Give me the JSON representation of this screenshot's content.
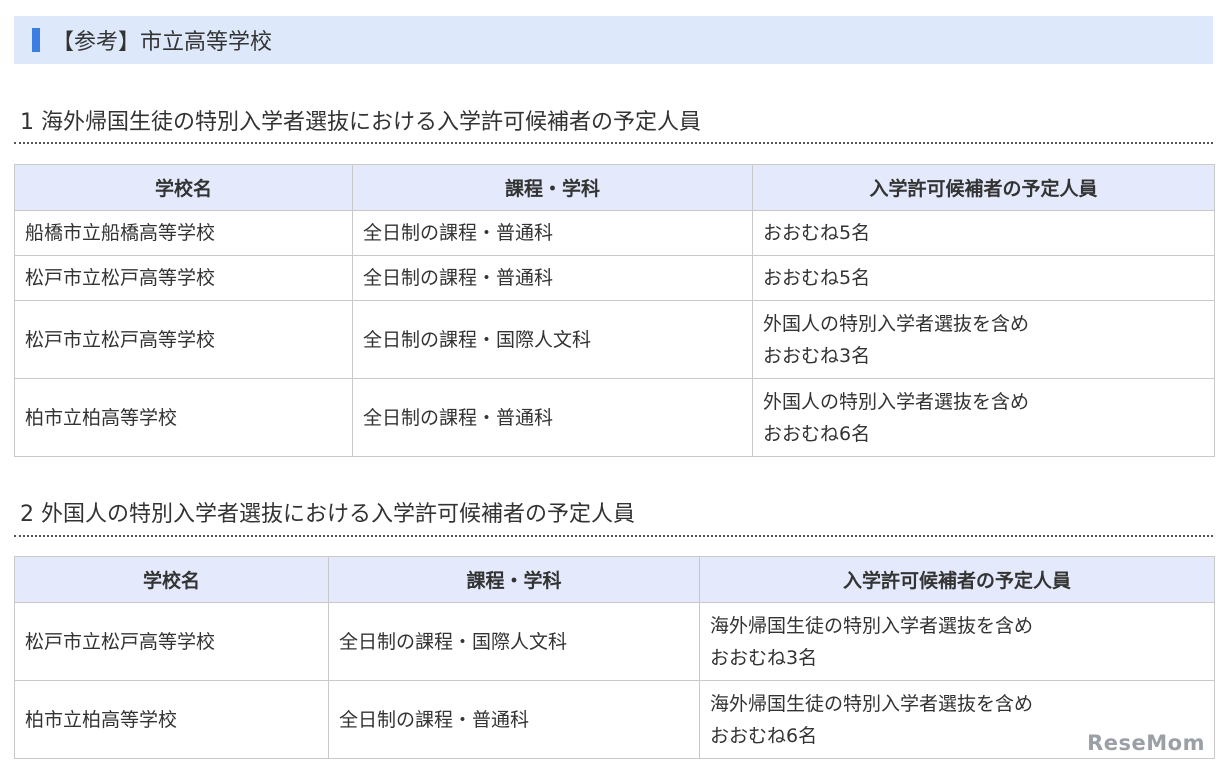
{
  "banner": {
    "title": "【参考】市立高等学校"
  },
  "section1": {
    "heading": "1 海外帰国生徒の特別入学者選抜における入学許可候補者の予定人員",
    "columns": [
      "学校名",
      "課程・学科",
      "入学許可候補者の予定人員"
    ],
    "rows": [
      {
        "school": "船橋市立船橋高等学校",
        "course": "全日制の課程・普通科",
        "quota": [
          "おおむね5名"
        ]
      },
      {
        "school": "松戸市立松戸高等学校",
        "course": "全日制の課程・普通科",
        "quota": [
          "おおむね5名"
        ]
      },
      {
        "school": "松戸市立松戸高等学校",
        "course": "全日制の課程・国際人文科",
        "quota": [
          "外国人の特別入学者選抜を含め",
          "おおむね3名"
        ]
      },
      {
        "school": "柏市立柏高等学校",
        "course": "全日制の課程・普通科",
        "quota": [
          "外国人の特別入学者選抜を含め",
          "おおむね6名"
        ]
      }
    ]
  },
  "section2": {
    "heading": "2 外国人の特別入学者選抜における入学許可候補者の予定人員",
    "columns": [
      "学校名",
      "課程・学科",
      "入学許可候補者の予定人員"
    ],
    "rows": [
      {
        "school": "松戸市立松戸高等学校",
        "course": "全日制の課程・国際人文科",
        "quota": [
          "海外帰国生徒の特別入学者選抜を含め",
          "おおむね3名"
        ]
      },
      {
        "school": "柏市立柏高等学校",
        "course": "全日制の課程・普通科",
        "quota": [
          "海外帰国生徒の特別入学者選抜を含め",
          "おおむね6名"
        ]
      }
    ]
  },
  "watermark": "ReseMom",
  "colors": {
    "banner_bg": "#dde8fb",
    "banner_accent": "#3b7de0",
    "header_bg": "#e4eafb",
    "border": "#c9c9c9"
  }
}
